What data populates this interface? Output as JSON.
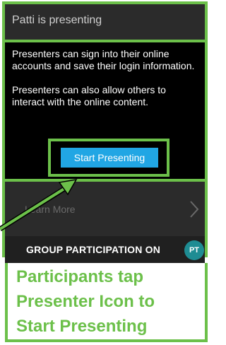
{
  "panel": {
    "title": "Patti is presenting",
    "paragraph_1": "Presenters can sign into their online accounts and save their login information.",
    "paragraph_2": "Presenters can also allow others to interact with the online content.",
    "button_label": "Start Presenting",
    "learn_more_label": "Learn More",
    "group_status_label": "GROUP PARTICIPATION ON",
    "avatar_initials": "PT"
  },
  "annotation": {
    "caption_line_1": "Participants tap",
    "caption_line_2": "Presenter Icon to",
    "caption_line_3": "Start Presenting"
  },
  "colors": {
    "accent_green": "#6cc04a",
    "button_blue": "#21a6e4",
    "avatar_teal": "#1e8c93",
    "panel_dark": "#2b2b2b"
  }
}
